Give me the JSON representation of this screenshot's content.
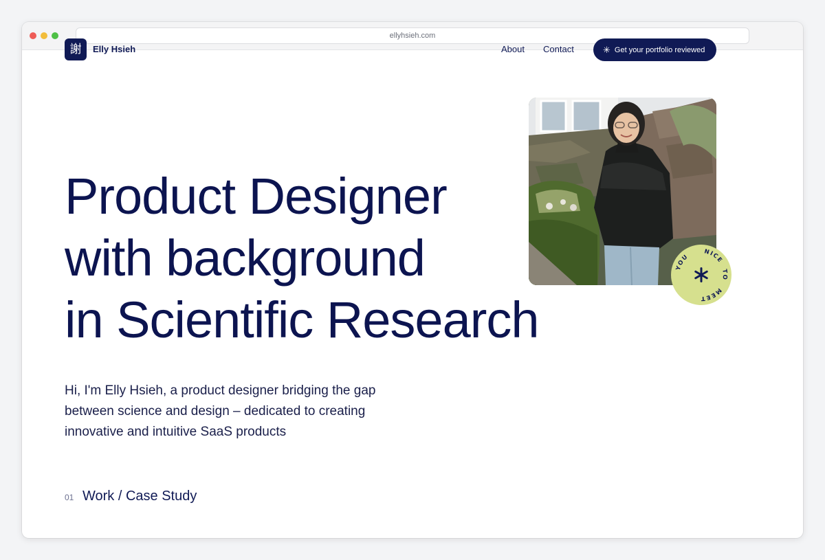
{
  "browser": {
    "url": "ellyhsieh.com"
  },
  "header": {
    "logo_glyph": "謝",
    "brand_name": "Elly Hsieh",
    "nav": {
      "about": "About",
      "contact": "Contact"
    },
    "cta_label": "Get your portfolio reviewed",
    "cta_icon": "asterisk-spark-icon"
  },
  "hero": {
    "title_lines": [
      "Product Designer",
      "with background",
      "in Scientific Research"
    ],
    "intro_lines": [
      "Hi, I'm Elly Hsieh, a product designer bridging the gap",
      "between science and design – dedicated to creating",
      "innovative and intuitive SaaS products"
    ]
  },
  "photo": {
    "sticker_words": [
      "NICE",
      "TO",
      "MEET",
      "YOU"
    ],
    "sticker_color": "#d6e08e"
  },
  "section": {
    "number": "01",
    "title": "Work / Case Study"
  },
  "colors": {
    "navy": "#101a55",
    "title_navy": "#0c1450"
  }
}
